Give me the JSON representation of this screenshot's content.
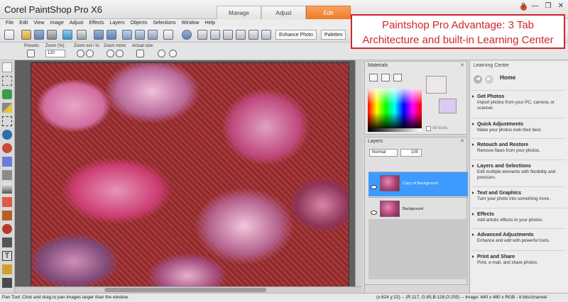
{
  "window": {
    "title": "Corel PaintShop Pro X6",
    "controls": [
      "?",
      "—",
      "❐",
      "✕"
    ]
  },
  "tabs": [
    {
      "label": "Manage",
      "active": false
    },
    {
      "label": "Adjust",
      "active": false
    },
    {
      "label": "Edit",
      "active": true
    }
  ],
  "menu": [
    "File",
    "Edit",
    "View",
    "Image",
    "Adjust",
    "Effects",
    "Layers",
    "Objects",
    "Selections",
    "Window",
    "Help"
  ],
  "toolbar": {
    "enhance_photo": "Enhance Photo",
    "palettes": "Palettes"
  },
  "tool_options": {
    "presets_label": "Presets:",
    "zoom_label": "Zoom (%):",
    "zoom_value": "120",
    "zoom_out_label": "Zoom out / in:",
    "zoom_more_label": "Zoom more:",
    "actual_size_label": "Actual size:"
  },
  "materials": {
    "title": "Materials",
    "all_tools": "All tools",
    "foreground_color": "#efe6ec",
    "background_color": "#dccbf0"
  },
  "layers": {
    "title": "Layers",
    "blend_mode": "Normal",
    "opacity": "100",
    "items": [
      {
        "name": "Copy of Background",
        "selected": true
      },
      {
        "name": "Background",
        "selected": false
      }
    ]
  },
  "learning_center": {
    "title": "Learning Center",
    "home": "Home",
    "items": [
      {
        "heading": "Get Photos",
        "desc": "Import photos from your PC, camera, or scanner."
      },
      {
        "heading": "Quick Adjustments",
        "desc": "Make your photos look their best."
      },
      {
        "heading": "Retouch and Restore",
        "desc": "Remove flaws from your photos."
      },
      {
        "heading": "Layers and Selections",
        "desc": "Edit multiple elements with flexibility and precision."
      },
      {
        "heading": "Text and Graphics",
        "desc": "Turn your photo into something more."
      },
      {
        "heading": "Effects",
        "desc": "Add artistic effects to your photos."
      },
      {
        "heading": "Advanced Adjustments",
        "desc": "Enhance and edit with powerful tools."
      },
      {
        "heading": "Print and Share",
        "desc": "Print, e-mail, and share photos."
      }
    ]
  },
  "status": {
    "left": "Pan Tool: Click and drag to pan images larger than the window.",
    "right": "(x:624 y:22) -- (R:117, G:85,B:128,O:255) -- Image: 640 x 480 x RGB - 8 bits/channel"
  },
  "callout": {
    "line1": "Paintshop Pro Advantage: 3 Tab",
    "line2": "Architecture and built-in Learning Center"
  },
  "colors": {
    "accent": "#ee7a26",
    "selection": "#3d9bff",
    "callout": "#d0262b"
  }
}
